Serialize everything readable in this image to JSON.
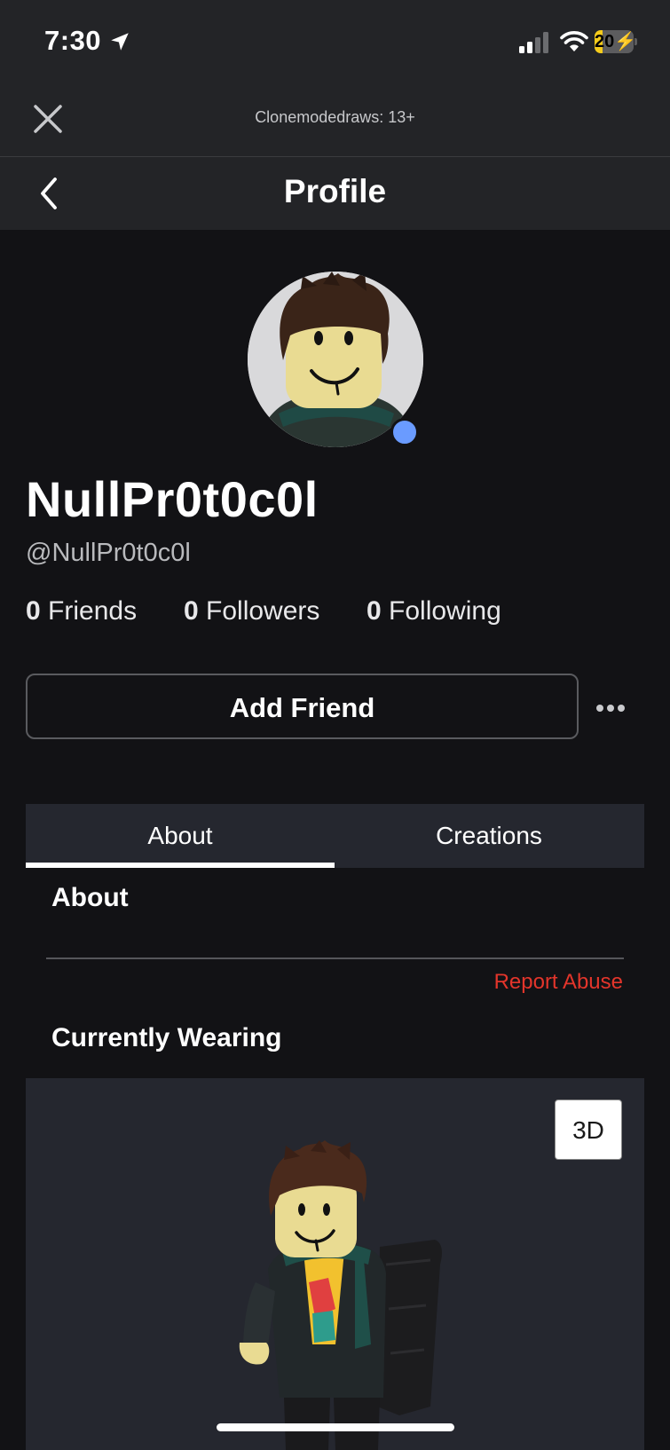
{
  "status_bar": {
    "time": "7:30",
    "battery": "20",
    "battery_fraction": 0.2,
    "icons": [
      "location-arrow-icon",
      "cellular-signal-icon",
      "wifi-icon",
      "battery-charging-icon"
    ]
  },
  "browser_bar": {
    "site_label": "Clonemodedraws: 13+",
    "close_icon": "close-icon"
  },
  "nav": {
    "title": "Profile",
    "back_icon": "chevron-left-icon"
  },
  "profile": {
    "display_name": "NullPr0t0c0l",
    "username": "@NullPr0t0c0l",
    "presence_color": "#6a9bff",
    "stats": [
      {
        "count": "0",
        "label": "Friends"
      },
      {
        "count": "0",
        "label": "Followers"
      },
      {
        "count": "0",
        "label": "Following"
      }
    ]
  },
  "actions": {
    "add_friend": "Add Friend",
    "more_icon": "more-horizontal-icon"
  },
  "tabs": [
    {
      "label": "About",
      "selected": true
    },
    {
      "label": "Creations",
      "selected": false
    }
  ],
  "about": {
    "heading": "About",
    "report_abuse": "Report Abuse",
    "report_color": "#e3352b"
  },
  "wearing": {
    "heading": "Currently Wearing",
    "view_3d": "3D"
  }
}
